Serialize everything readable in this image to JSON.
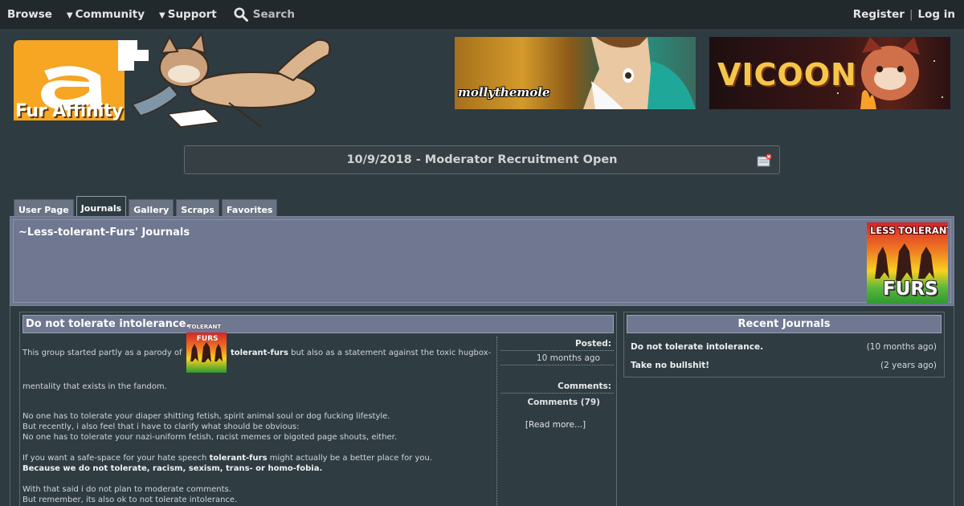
{
  "nav": {
    "browse": "Browse",
    "community": "Community",
    "support": "Support",
    "search": "Search",
    "register": "Register",
    "separator": "|",
    "login": "Log in",
    "caret": "▼"
  },
  "logo": {
    "text": "Fur Affinity"
  },
  "banners": [
    {
      "text": "mollythemole"
    },
    {
      "text": "VICOON"
    }
  ],
  "notice": {
    "text": "10/9/2018 - Moderator Recruitment Open"
  },
  "tabs": [
    "User Page",
    "Journals",
    "Gallery",
    "Scraps",
    "Favorites"
  ],
  "header": {
    "title": "~Less-tolerant-Furs' Journals",
    "avatar_lines": [
      "LESS TOLERANT",
      "FURS"
    ]
  },
  "journal": {
    "title": "Do not tolerate intolerance.",
    "intro_before": "This group started partly as a parody of",
    "intro_icon_lines": [
      "TOLERANT",
      "FURS"
    ],
    "intro_link": "tolerant-furs",
    "intro_after": "but also as a statement against the toxic hugbox-mentality that exists in the fandom.",
    "p2_l1": "No one has to tolerate your diaper shitting fetish, spirit animal soul or dog fucking lifestyle.",
    "p2_l2": "But recently, i also feel that i have to clarify what should be obvious:",
    "p2_l3": "No one has to tolerate your nazi-uniform fetish, racist memes or bigoted page shouts, either.",
    "p3_before": "If you want a safe-space for your hate speech",
    "p3_link": "tolerant-furs",
    "p3_after": "might actually be a better place for you.",
    "p3_bold": "Because we do not tolerate, racism, sexism, trans- or homo-fobia.",
    "p4_l1": "With that said i do not plan to moderate comments.",
    "p4_l2": "But remember, its also ok to not tolerate intolerance."
  },
  "meta": {
    "posted_label": "Posted:",
    "posted_value": "10 months ago",
    "comments_label": "Comments:",
    "comments_value": "Comments (79)",
    "read_more": "[Read more...]"
  },
  "recent": {
    "title": "Recent Journals",
    "items": [
      {
        "title": "Do not tolerate intolerance.",
        "time": "(10 months ago)"
      },
      {
        "title": "Take no bullshit!",
        "time": "(2 years ago)"
      }
    ]
  }
}
